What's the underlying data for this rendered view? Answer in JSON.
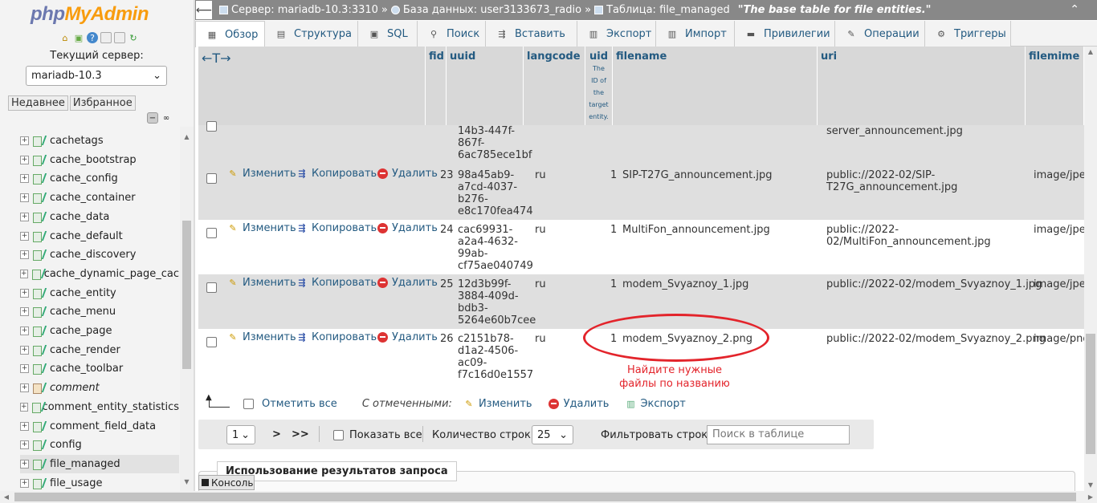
{
  "sidebar": {
    "logo_php": "php",
    "logo_myadmin": "MyAdmin",
    "current_server_label": "Текущий сервер:",
    "server_value": "mariadb-10.3",
    "recent_label": "Недавнее",
    "favorites_label": "Избранное",
    "tables": [
      {
        "name": "cachetags",
        "type": "table"
      },
      {
        "name": "cache_bootstrap",
        "type": "table"
      },
      {
        "name": "cache_config",
        "type": "table"
      },
      {
        "name": "cache_container",
        "type": "table"
      },
      {
        "name": "cache_data",
        "type": "table"
      },
      {
        "name": "cache_default",
        "type": "table"
      },
      {
        "name": "cache_discovery",
        "type": "table"
      },
      {
        "name": "cache_dynamic_page_cac",
        "type": "table"
      },
      {
        "name": "cache_entity",
        "type": "table"
      },
      {
        "name": "cache_menu",
        "type": "table"
      },
      {
        "name": "cache_page",
        "type": "table"
      },
      {
        "name": "cache_render",
        "type": "table"
      },
      {
        "name": "cache_toolbar",
        "type": "table"
      },
      {
        "name": "comment",
        "type": "view"
      },
      {
        "name": "comment_entity_statistics",
        "type": "table"
      },
      {
        "name": "comment_field_data",
        "type": "table"
      },
      {
        "name": "config",
        "type": "table"
      },
      {
        "name": "file_managed",
        "type": "table",
        "selected": true
      },
      {
        "name": "file_usage",
        "type": "table"
      }
    ]
  },
  "breadcrumb": {
    "server": "Сервер: mariadb-10.3:3310",
    "database": "База данных: user3133673_radio",
    "table": "Таблица: file_managed",
    "comment": "\"The base table for file entities.\"",
    "separator": "»"
  },
  "tabs": [
    {
      "label": "Обзор",
      "icon": "browse-icon",
      "glyph": "▦",
      "active": true
    },
    {
      "label": "Структура",
      "icon": "structure-icon",
      "glyph": "▤"
    },
    {
      "label": "SQL",
      "icon": "sql-icon",
      "glyph": "▣"
    },
    {
      "label": "Поиск",
      "icon": "search-icon",
      "glyph": "⚲"
    },
    {
      "label": "Вставить",
      "icon": "insert-icon",
      "glyph": "⇶"
    },
    {
      "label": "Экспорт",
      "icon": "export-icon",
      "glyph": "▥"
    },
    {
      "label": "Импорт",
      "icon": "import-icon",
      "glyph": "▥"
    },
    {
      "label": "Привилегии",
      "icon": "privileges-icon",
      "glyph": "▬"
    },
    {
      "label": "Операции",
      "icon": "operations-icon",
      "glyph": "✎"
    },
    {
      "label": "Триггеры",
      "icon": "triggers-icon",
      "glyph": "⚙"
    }
  ],
  "table": {
    "header_arrows": "←T→",
    "columns": [
      "fid",
      "uuid",
      "langcode",
      "uid",
      "filename",
      "uri",
      "filemime"
    ],
    "uid_comment": [
      "The",
      "ID of",
      "the",
      "target",
      "entity."
    ],
    "actions": {
      "edit": "Изменить",
      "copy": "Копировать",
      "delete": "Удалить"
    },
    "partial_row": {
      "uuid": "14b3-447f-\n867f-\n6ac785ece1bf",
      "uri": "server_announcement.jpg"
    },
    "rows": [
      {
        "fid": "23",
        "uuid": "98a45ab9-\na7cd-4037-\nb276-\ne8c170fea474",
        "langcode": "ru",
        "uid": "1",
        "filename": "SIP-T27G_announcement.jpg",
        "uri": "public://2022-02/SIP-\nT27G_announcement.jpg",
        "filemime": "image/jpeg"
      },
      {
        "fid": "24",
        "uuid": "cac69931-\na2a4-4632-\n99ab-\ncf75ae040749",
        "langcode": "ru",
        "uid": "1",
        "filename": "MultiFon_announcement.jpg",
        "uri": "public://2022-\n02/MultiFon_announcement.jpg",
        "filemime": "image/jpeg"
      },
      {
        "fid": "25",
        "uuid": "12d3b99f-\n3884-409d-\nbdb3-\n5264e60b7cee",
        "langcode": "ru",
        "uid": "1",
        "filename": "modem_Svyaznoy_1.jpg",
        "uri": "public://2022-02/modem_Svyaznoy_1.jpg",
        "filemime": "image/jpeg"
      },
      {
        "fid": "26",
        "uuid": "c2151b78-\nd1a2-4506-\nac09-\nf7c16d0e1557",
        "langcode": "ru",
        "uid": "1",
        "filename": "modem_Svyaznoy_2.png",
        "uri": "public://2022-02/modem_Svyaznoy_2.png",
        "filemime": "image/png"
      }
    ]
  },
  "annotation": {
    "line1": "Найдите нужные",
    "line2": "файлы по названию",
    "color": "#e3242b"
  },
  "bulk": {
    "check_all": "Отметить все",
    "with_selected": "С отмеченными:",
    "edit": "Изменить",
    "delete": "Удалить",
    "export": "Экспорт"
  },
  "navigation": {
    "page_value": "1",
    "next": ">",
    "last": ">>",
    "show_all": "Показать все",
    "rows_label": "Количество строк:",
    "rows_value": "25",
    "filter_label": "Фильтровать строки:",
    "filter_placeholder": "Поиск в таблице"
  },
  "query_results_label": "Использование результатов запроса",
  "console_label": "Консоль",
  "colors": {
    "link": "#235a81",
    "header_bg": "#d8d8d8",
    "row_alt": "#dfdfdf",
    "breadcrumb_bg": "#888888"
  }
}
